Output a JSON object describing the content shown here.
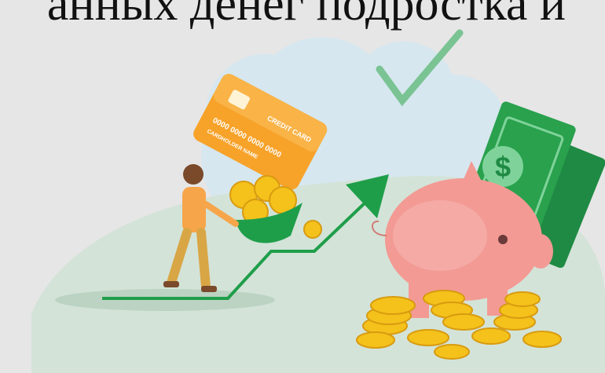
{
  "slide": {
    "title_fragment": "анных денег подростка и"
  },
  "credit_card": {
    "label": "CREDIT CARD",
    "number": "0000 0000 0000 0000",
    "holder": "CARDHOLDER NAME"
  },
  "colors": {
    "background": "#e6e6e6",
    "blob": "#d6e7ef",
    "hill": "#d3e3d8",
    "arrow_green": "#1f9e4a",
    "money_green": "#29a14d",
    "coin_gold": "#f4c21b",
    "card_orange": "#f7a229",
    "piggy_pink": "#f39a94"
  },
  "icons": [
    "checkmark-icon",
    "dollar-icon",
    "growth-arrow-icon"
  ]
}
